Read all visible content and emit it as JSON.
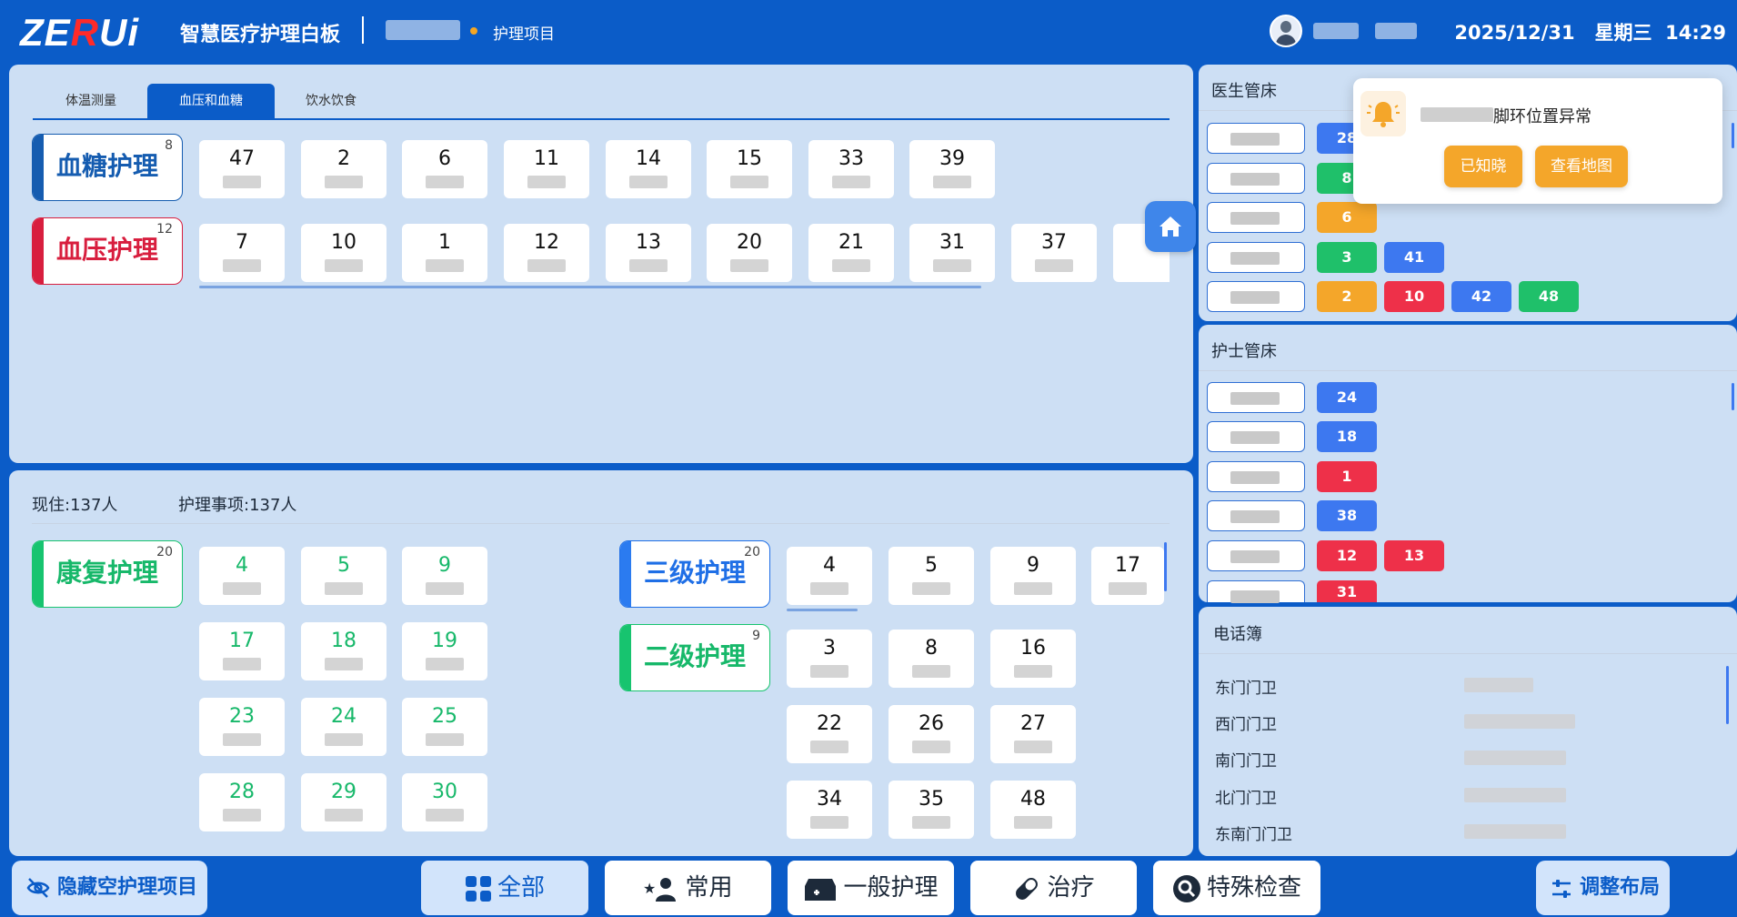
{
  "header": {
    "logo_text": "ZERUi",
    "app_title": "智慧医疗护理白板",
    "breadcrumb": "护理项目",
    "date": "2025/12/31",
    "weekday": "星期三",
    "time": "14:29"
  },
  "top_panel": {
    "tabs": [
      "体温测量",
      "血压和血糖",
      "饮水饮食"
    ],
    "active_tab": 1,
    "categories": [
      {
        "label": "血糖护理",
        "count": "8",
        "beds": [
          "47",
          "2",
          "6",
          "11",
          "14",
          "15",
          "33",
          "39"
        ]
      },
      {
        "label": "血压护理",
        "count": "12",
        "beds": [
          "7",
          "10",
          "1",
          "12",
          "13",
          "20",
          "21",
          "31",
          "37"
        ]
      }
    ]
  },
  "bottom_panel": {
    "resident_count": "现住:137人",
    "care_count": "护理事项:137人",
    "left_category": {
      "label": "康复护理",
      "count": "20",
      "beds": [
        "4",
        "5",
        "9",
        "17",
        "18",
        "19",
        "23",
        "24",
        "25",
        "28",
        "29",
        "30"
      ]
    },
    "right_categories": [
      {
        "label": "三级护理",
        "count": "20",
        "beds": [
          "4",
          "5",
          "9",
          "17"
        ]
      },
      {
        "label": "二级护理",
        "count": "9",
        "beds": [
          "3",
          "8",
          "16",
          "22",
          "26",
          "27",
          "34",
          "35",
          "48"
        ]
      }
    ]
  },
  "doctor_panel": {
    "title": "医生管床",
    "rows": [
      [
        "28"
      ],
      [
        "8"
      ],
      [
        "6"
      ],
      [
        "3",
        "41"
      ],
      [
        "2",
        "10",
        "42",
        "48"
      ]
    ]
  },
  "nurse_panel": {
    "title": "护士管床",
    "rows": [
      [
        "24"
      ],
      [
        "18"
      ],
      [
        "1"
      ],
      [
        "38"
      ],
      [
        "12",
        "13"
      ],
      [
        "31"
      ]
    ]
  },
  "phonebook": {
    "title": "电话簿",
    "entries": [
      "东门门卫",
      "西门门卫",
      "南门门卫",
      "北门门卫",
      "东南门门卫"
    ]
  },
  "notification": {
    "message": "脚环位置异常",
    "ack_label": "已知晓",
    "map_label": "查看地图"
  },
  "bottom_bar": {
    "hide_label": "隐藏空护理项目",
    "filters": [
      "全部",
      "常用",
      "一般护理",
      "治疗",
      "特殊检查"
    ],
    "active_filter": 0,
    "layout_label": "调整布局"
  },
  "colors": {
    "brand": "#0b5cc8",
    "panel_bg": "#cddff4",
    "blue_badge": "#3d78f0",
    "green_badge": "#1fc06a",
    "orange_badge": "#f4a62a",
    "red_badge": "#ee3049"
  }
}
